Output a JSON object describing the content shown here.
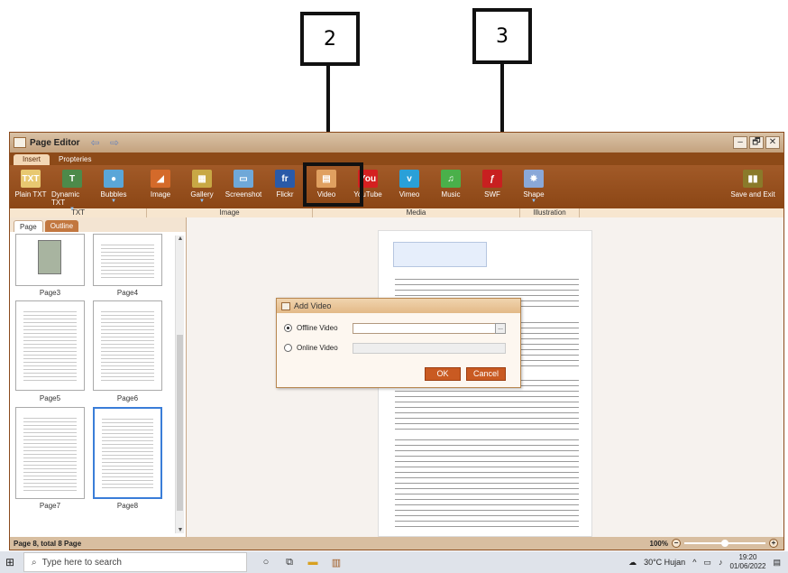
{
  "callouts": {
    "c2": "2",
    "c3": "3"
  },
  "window": {
    "title": "Page Editor",
    "nav": "⇦ ⇨",
    "controls": {
      "min": "–",
      "max": "🗗",
      "close": "✕"
    }
  },
  "tabs": [
    {
      "label": "Insert"
    },
    {
      "label": "Propteries"
    }
  ],
  "ribbon": {
    "buttons": [
      {
        "label": "Plain TXT",
        "icon": "plain-txt-icon",
        "glyph": "TXT",
        "color": "#e8c870"
      },
      {
        "label": "Dynamic TXT",
        "icon": "dynamic-txt-icon",
        "glyph": "T",
        "color": "#4d8a4a"
      },
      {
        "label": "Bubbles",
        "icon": "bubbles-icon",
        "glyph": "●",
        "color": "#5aa6d8"
      },
      {
        "label": "Image",
        "icon": "image-icon",
        "glyph": "◢",
        "color": "#d46a2a"
      },
      {
        "label": "Gallery",
        "icon": "gallery-icon",
        "glyph": "▦",
        "color": "#c8a845"
      },
      {
        "label": "Screenshot",
        "icon": "screenshot-icon",
        "glyph": "▭",
        "color": "#6fa8d8"
      },
      {
        "label": "Flickr",
        "icon": "flickr-icon",
        "glyph": "fr",
        "color": "#2a5aa8"
      },
      {
        "label": "Video",
        "icon": "video-icon",
        "glyph": "▤",
        "color": "#e0a060"
      },
      {
        "label": "YouTube",
        "icon": "youtube-icon",
        "glyph": "You",
        "color": "#d42020"
      },
      {
        "label": "Vimeo",
        "icon": "vimeo-icon",
        "glyph": "v",
        "color": "#2aa0d8"
      },
      {
        "label": "Music",
        "icon": "music-icon",
        "glyph": "♫",
        "color": "#4ab04a"
      },
      {
        "label": "SWF",
        "icon": "swf-icon",
        "glyph": "ƒ",
        "color": "#c82020"
      },
      {
        "label": "Shape",
        "icon": "shape-icon",
        "glyph": "✸",
        "color": "#8aa8d8"
      }
    ],
    "save_exit": "Save and Exit",
    "groups": {
      "txt": "TXT",
      "image": "Image",
      "media": "Media",
      "illustration": "Illustration"
    }
  },
  "panel": {
    "tabs": [
      {
        "label": "Page"
      },
      {
        "label": "Outline"
      }
    ],
    "pages": [
      "Page3",
      "Page4",
      "Page5",
      "Page6",
      "Page7",
      "Page8"
    ]
  },
  "dialog": {
    "title": "Add Video",
    "offline_label": "Offline Video",
    "online_label": "Online Video",
    "browse": "...",
    "ok": "OK",
    "cancel": "Cancel"
  },
  "status": {
    "text": "Page 8, total 8 Page",
    "zoom": "100%",
    "zoom_level": 0.5
  },
  "taskbar": {
    "search_placeholder": "Type here to search",
    "weather": "30°C Hujan",
    "time": "19:20",
    "date": "01/06/2022"
  }
}
